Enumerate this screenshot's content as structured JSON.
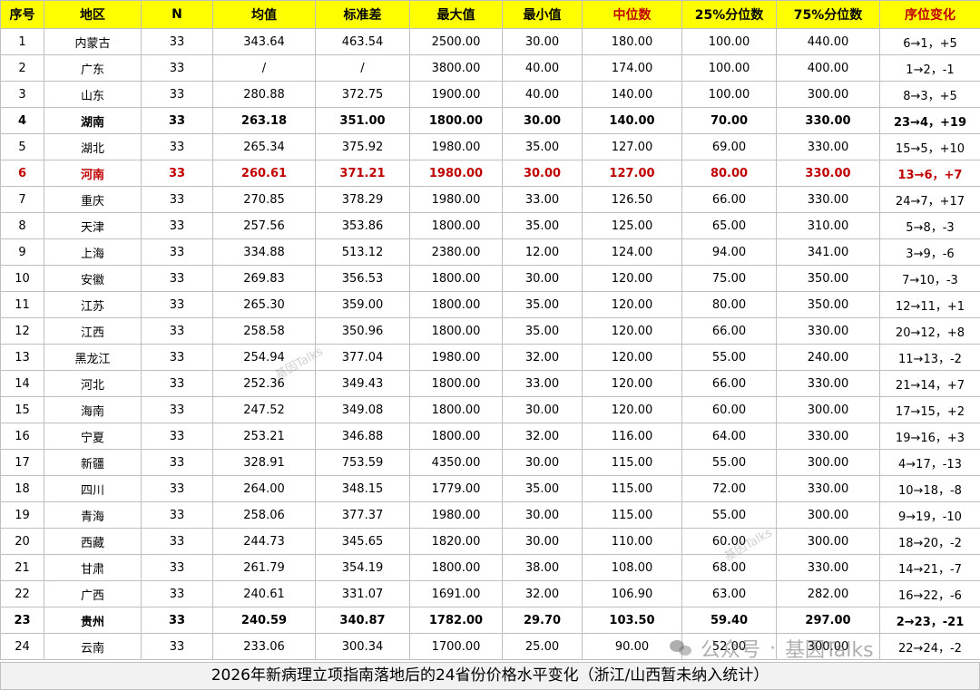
{
  "table": {
    "headers": [
      "序号",
      "地区",
      "N",
      "均值",
      "标准差",
      "最大值",
      "最小值",
      "中位数",
      "25%分位数",
      "75%分位数",
      "序位变化"
    ],
    "red_headers": [
      "中位数",
      "序位变化"
    ],
    "rows": [
      [
        "1",
        "内蒙古",
        "33",
        "343.64",
        "463.54",
        "2500.00",
        "30.00",
        "180.00",
        "100.00",
        "440.00",
        "6→1，+5"
      ],
      [
        "2",
        "广东",
        "33",
        "/",
        "/",
        "3800.00",
        "40.00",
        "174.00",
        "100.00",
        "400.00",
        "1→2，-1"
      ],
      [
        "3",
        "山东",
        "33",
        "280.88",
        "372.75",
        "1900.00",
        "40.00",
        "140.00",
        "100.00",
        "300.00",
        "8→3，+5"
      ],
      [
        "4",
        "湖南",
        "33",
        "263.18",
        "351.00",
        "1800.00",
        "30.00",
        "140.00",
        "70.00",
        "330.00",
        "23→4，+19"
      ],
      [
        "5",
        "湖北",
        "33",
        "265.34",
        "375.92",
        "1980.00",
        "35.00",
        "127.00",
        "69.00",
        "330.00",
        "15→5，+10"
      ],
      [
        "6",
        "河南",
        "33",
        "260.61",
        "371.21",
        "1980.00",
        "30.00",
        "127.00",
        "80.00",
        "330.00",
        "13→6，+7"
      ],
      [
        "7",
        "重庆",
        "33",
        "270.85",
        "378.29",
        "1980.00",
        "33.00",
        "126.50",
        "66.00",
        "330.00",
        "24→7，+17"
      ],
      [
        "8",
        "天津",
        "33",
        "257.56",
        "353.86",
        "1800.00",
        "35.00",
        "125.00",
        "65.00",
        "310.00",
        "5→8，-3"
      ],
      [
        "9",
        "上海",
        "33",
        "334.88",
        "513.12",
        "2380.00",
        "12.00",
        "124.00",
        "94.00",
        "341.00",
        "3→9，-6"
      ],
      [
        "10",
        "安徽",
        "33",
        "269.83",
        "356.53",
        "1800.00",
        "30.00",
        "120.00",
        "75.00",
        "350.00",
        "7→10，-3"
      ],
      [
        "11",
        "江苏",
        "33",
        "265.30",
        "359.00",
        "1800.00",
        "35.00",
        "120.00",
        "80.00",
        "350.00",
        "12→11，+1"
      ],
      [
        "12",
        "江西",
        "33",
        "258.58",
        "350.96",
        "1800.00",
        "35.00",
        "120.00",
        "66.00",
        "330.00",
        "20→12，+8"
      ],
      [
        "13",
        "黑龙江",
        "33",
        "254.94",
        "377.04",
        "1980.00",
        "32.00",
        "120.00",
        "55.00",
        "240.00",
        "11→13，-2"
      ],
      [
        "14",
        "河北",
        "33",
        "252.36",
        "349.43",
        "1800.00",
        "33.00",
        "120.00",
        "66.00",
        "330.00",
        "21→14，+7"
      ],
      [
        "15",
        "海南",
        "33",
        "247.52",
        "349.08",
        "1800.00",
        "30.00",
        "120.00",
        "60.00",
        "300.00",
        "17→15，+2"
      ],
      [
        "16",
        "宁夏",
        "33",
        "253.21",
        "346.88",
        "1800.00",
        "32.00",
        "116.00",
        "64.00",
        "330.00",
        "19→16，+3"
      ],
      [
        "17",
        "新疆",
        "33",
        "328.91",
        "753.59",
        "4350.00",
        "30.00",
        "115.00",
        "55.00",
        "300.00",
        "4→17，-13"
      ],
      [
        "18",
        "四川",
        "33",
        "264.00",
        "348.15",
        "1779.00",
        "35.00",
        "115.00",
        "72.00",
        "330.00",
        "10→18，-8"
      ],
      [
        "19",
        "青海",
        "33",
        "258.06",
        "377.37",
        "1980.00",
        "30.00",
        "115.00",
        "55.00",
        "300.00",
        "9→19，-10"
      ],
      [
        "20",
        "西藏",
        "33",
        "244.73",
        "345.65",
        "1820.00",
        "30.00",
        "110.00",
        "60.00",
        "300.00",
        "18→20，-2"
      ],
      [
        "21",
        "甘肃",
        "33",
        "261.79",
        "354.19",
        "1800.00",
        "38.00",
        "108.00",
        "68.00",
        "330.00",
        "14→21，-7"
      ],
      [
        "22",
        "广西",
        "33",
        "240.61",
        "331.07",
        "1691.00",
        "32.00",
        "106.90",
        "63.00",
        "282.00",
        "16→22，-6"
      ],
      [
        "23",
        "贵州",
        "33",
        "240.59",
        "340.87",
        "1782.00",
        "29.70",
        "103.50",
        "59.40",
        "297.00",
        "2→23，-21"
      ],
      [
        "24",
        "云南",
        "33",
        "233.06",
        "300.34",
        "1700.00",
        "25.00",
        "90.00",
        "52.00",
        "300.00",
        "22→24，-2"
      ]
    ],
    "bold_rows": [
      4,
      23
    ],
    "highlight_row": 6
  },
  "caption": "2026年新病理立项指南落地后的24省份价格水平变化（浙江/山西暂未纳入统计）",
  "watermark": {
    "text": "基因Talks",
    "account_label": "公众号",
    "separator": "·"
  },
  "colors": {
    "header_bg": "#ffff00",
    "accent_red": "#c00000",
    "caption_bg": "#f2f2f2",
    "border": "#bfbfbf"
  }
}
